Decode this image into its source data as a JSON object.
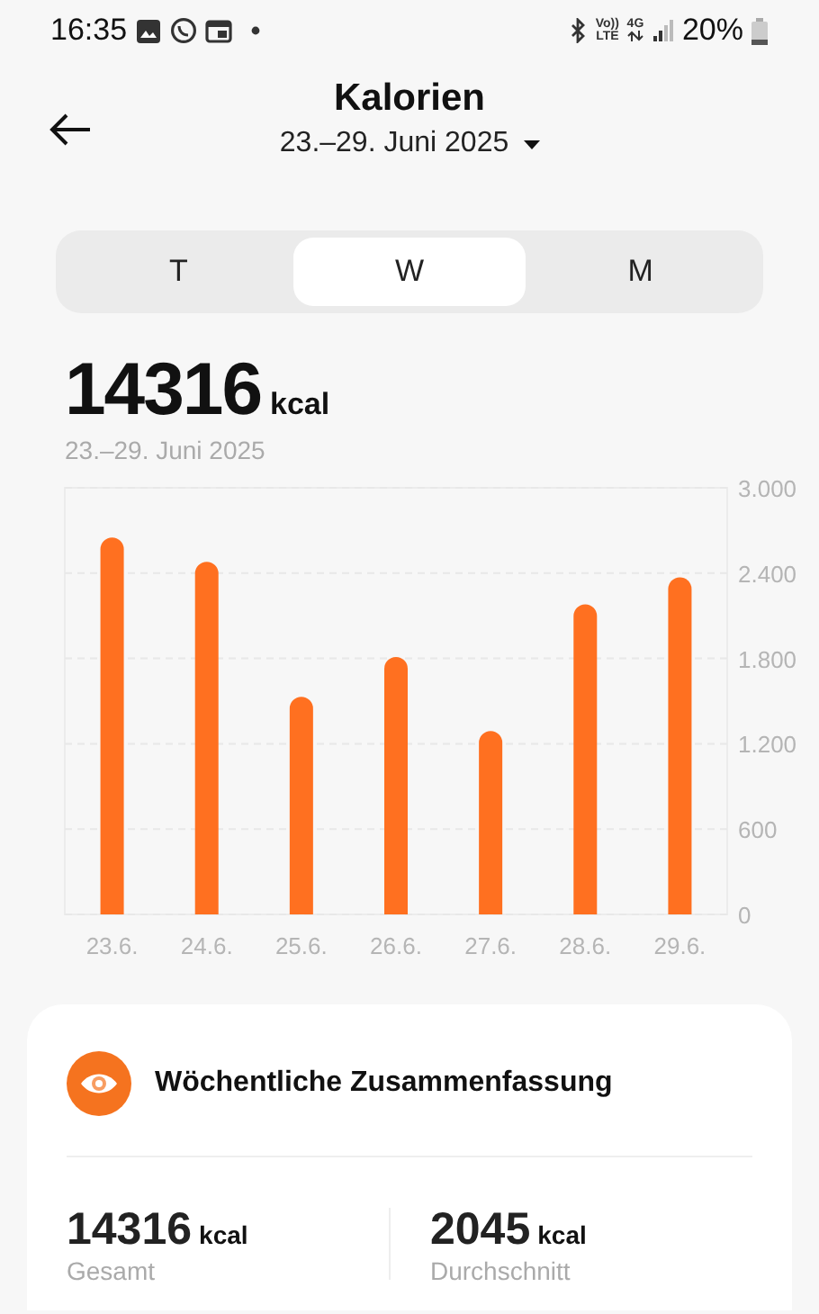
{
  "status_bar": {
    "time": "16:35",
    "network_top": "Vo))",
    "network_bottom": "LTE",
    "data_type": "4G",
    "battery": "20%"
  },
  "header": {
    "title": "Kalorien",
    "period": "23.–29. Juni 2025"
  },
  "tabs": [
    {
      "label": "T",
      "selected": false
    },
    {
      "label": "W",
      "selected": true
    },
    {
      "label": "M",
      "selected": false
    }
  ],
  "total": {
    "value": "14316",
    "unit": "kcal",
    "range": "23.–29. Juni 2025"
  },
  "chart": {
    "chart_data": {
      "type": "bar",
      "categories": [
        "23.6.",
        "24.6.",
        "25.6.",
        "26.6.",
        "27.6.",
        "28.6.",
        "29.6."
      ],
      "series": [
        {
          "color": "#ff7020",
          "values": [
            2650,
            2480,
            1530,
            1810,
            1290,
            2180,
            2370
          ]
        }
      ],
      "grid": true,
      "ylim": [
        0,
        3000
      ],
      "yticks": [
        {
          "value": 0,
          "label": "0"
        },
        {
          "value": 600,
          "label": "600"
        },
        {
          "value": 1200,
          "label": "1.200"
        },
        {
          "value": 1800,
          "label": "1.800"
        },
        {
          "value": 2400,
          "label": "2.400"
        },
        {
          "value": 3000,
          "label": "3.000"
        }
      ]
    }
  },
  "summary": {
    "title": "Wöchentliche Zusammenfassung",
    "stats": [
      {
        "value": "14316",
        "unit": "kcal",
        "label": "Gesamt"
      },
      {
        "value": "2045",
        "unit": "kcal",
        "label": "Durchschnitt"
      }
    ]
  }
}
